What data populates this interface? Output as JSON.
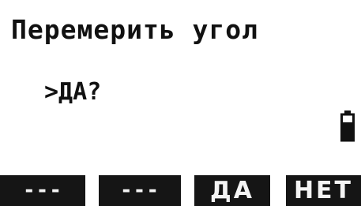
{
  "screen": {
    "title": "Перемерить угол",
    "prompt": ">ДА?"
  },
  "status": {
    "battery_icon": "battery-icon"
  },
  "softkeys": {
    "f1": "---",
    "f2": "---",
    "f3": "ДА",
    "f4": "НЕТ"
  }
}
